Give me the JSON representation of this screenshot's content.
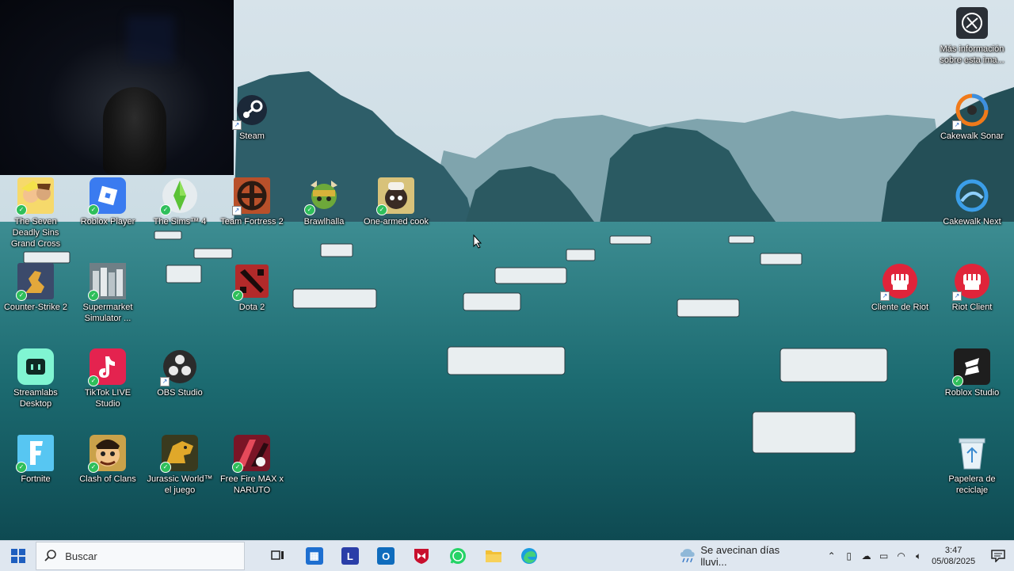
{
  "desktop": {
    "icons_left": [
      {
        "id": "steam",
        "label": "Steam",
        "icon": "steam-icon"
      },
      {
        "id": "seven-deadly",
        "label": "The Seven Deadly Sins Grand Cross",
        "icon": "seven-deadly-sins-icon"
      },
      {
        "id": "roblox-player",
        "label": "Roblox Player",
        "icon": "roblox-icon"
      },
      {
        "id": "sims4",
        "label": "The Sims™ 4",
        "icon": "sims-plumbob-icon"
      },
      {
        "id": "tf2",
        "label": "Team Fortress 2",
        "icon": "tf2-icon"
      },
      {
        "id": "brawlhalla",
        "label": "Brawlhalla",
        "icon": "brawlhalla-icon"
      },
      {
        "id": "one-armed",
        "label": "One-armed cook",
        "icon": "one-armed-cook-icon"
      },
      {
        "id": "cs2",
        "label": "Counter-Strike 2",
        "icon": "counter-strike-icon"
      },
      {
        "id": "supermarket",
        "label": "Supermarket Simulator ...",
        "icon": "supermarket-icon"
      },
      {
        "id": "dota2",
        "label": "Dota 2",
        "icon": "dota-icon"
      },
      {
        "id": "streamlabs",
        "label": "Streamlabs Desktop",
        "icon": "streamlabs-icon"
      },
      {
        "id": "tiktok",
        "label": "TikTok LIVE Studio",
        "icon": "tiktok-icon"
      },
      {
        "id": "obs",
        "label": "OBS Studio",
        "icon": "obs-icon"
      },
      {
        "id": "fortnite",
        "label": "Fortnite",
        "icon": "fortnite-icon"
      },
      {
        "id": "coc",
        "label": "Clash of Clans",
        "icon": "clash-of-clans-icon"
      },
      {
        "id": "jurassic",
        "label": "Jurassic World™ el juego",
        "icon": "jurassic-world-icon"
      },
      {
        "id": "freefire",
        "label": "Free Fire MAX x NARUTO",
        "icon": "free-fire-icon"
      }
    ],
    "icons_right": [
      {
        "id": "mas-info",
        "label": "Más información sobre esta ima...",
        "icon": "camera-icon"
      },
      {
        "id": "cakewalk-sonar",
        "label": "Cakewalk Sonar",
        "icon": "cakewalk-sonar-icon"
      },
      {
        "id": "cakewalk-next",
        "label": "Cakewalk Next",
        "icon": "cakewalk-next-icon"
      },
      {
        "id": "cliente-riot",
        "label": "Cliente de Riot",
        "icon": "riot-fist-icon"
      },
      {
        "id": "riot-client",
        "label": "Riot Client",
        "icon": "riot-fist-icon"
      },
      {
        "id": "roblox-studio",
        "label": "Roblox Studio",
        "icon": "roblox-studio-icon"
      },
      {
        "id": "papelera",
        "label": "Papelera de reciclaje",
        "icon": "recycle-bin-icon"
      }
    ]
  },
  "taskbar": {
    "search_placeholder": "Buscar",
    "apps": [
      "task-view-icon",
      "microsoft-store-icon",
      "l-app-icon",
      "outlook-icon",
      "mcafee-icon",
      "whatsapp-icon",
      "file-explorer-icon",
      "edge-icon"
    ],
    "weather_text": "Se avecinan días lluvi...",
    "time": "3:47",
    "date": "05/08/2025"
  },
  "colors": {
    "taskbar_bg": "#dfe7f0",
    "sky": "#c9dae3",
    "water": "#1d6b70"
  }
}
